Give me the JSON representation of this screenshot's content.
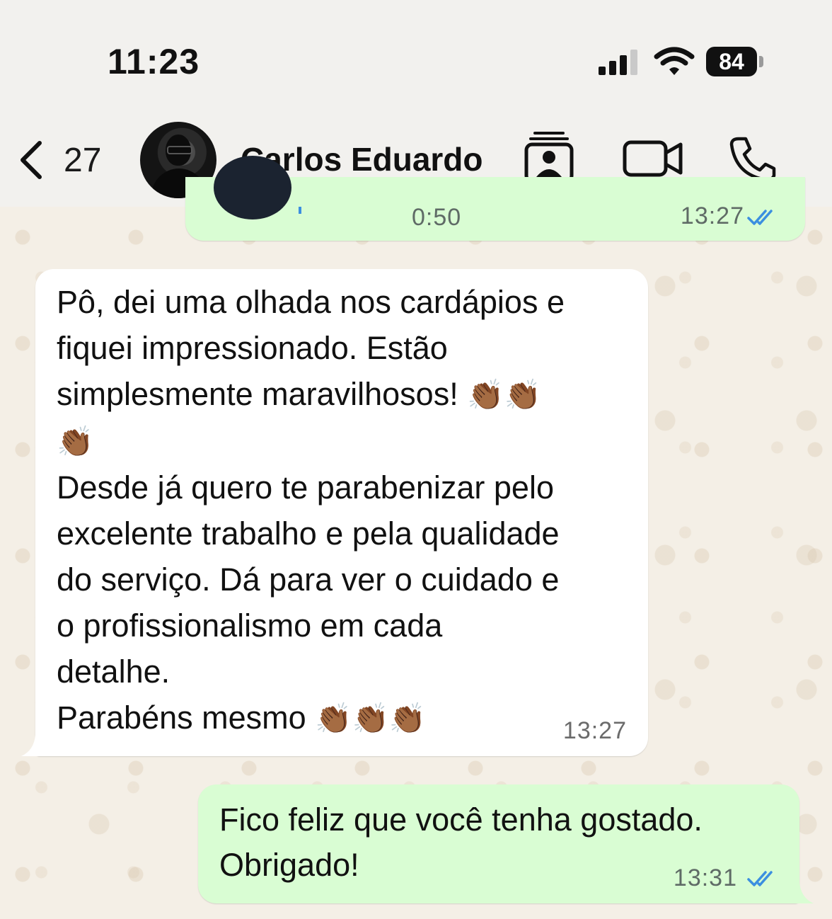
{
  "status_bar": {
    "time": "11:23",
    "battery": "84",
    "icons": [
      "cellular-signal-icon",
      "wifi-icon",
      "battery-icon"
    ]
  },
  "header": {
    "back_count": "27",
    "contact_name": "Carlos Eduardo",
    "icons": [
      "chevron-left-icon",
      "contact-card-icon",
      "video-call-icon",
      "phone-call-icon"
    ]
  },
  "messages": [
    {
      "type": "audio",
      "direction": "outgoing",
      "duration": "0:50",
      "time": "13:27",
      "status": "read"
    },
    {
      "type": "text",
      "direction": "incoming",
      "lines": [
        "Pô, dei uma olhada nos cardápios e",
        "fiquei impressionado. Estão",
        "simplesmente maravilhosos!",
        "Desde já quero te parabenizar pelo",
        "excelente trabalho e pela qualidade",
        "do serviço. Dá para ver o cuidado e",
        "o profissionalismo em cada",
        "detalhe.",
        "Parabéns mesmo"
      ],
      "emoji": "👏🏾",
      "time": "13:27"
    },
    {
      "type": "text",
      "direction": "outgoing",
      "lines": [
        "Fico feliz que você tenha gostado.",
        "Obrigado!"
      ],
      "time": "13:31",
      "status": "read"
    }
  ],
  "colors": {
    "outgoing_bubble": "#d9fdd3",
    "incoming_bubble": "#ffffff",
    "chat_background": "#f4efe6",
    "read_ticks": "#3b8fe0"
  }
}
